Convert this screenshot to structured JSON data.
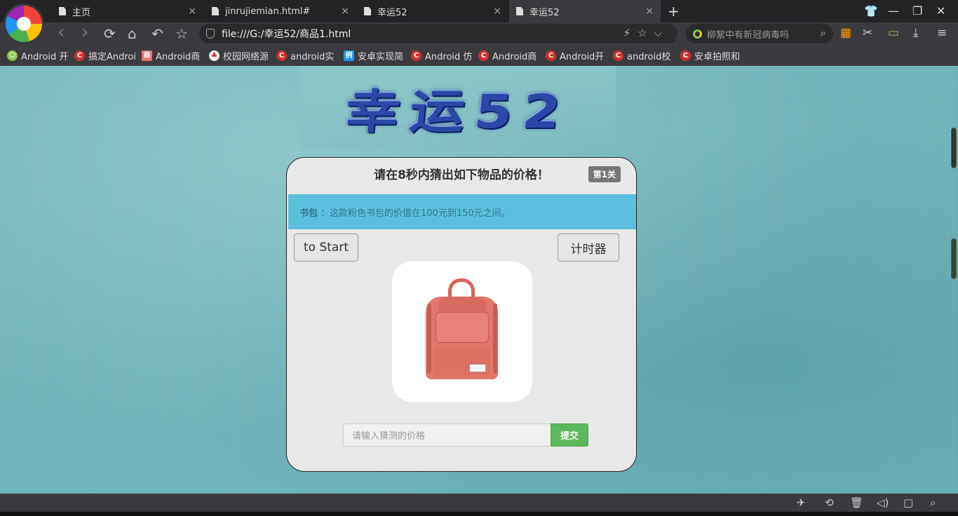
{
  "tabs": [
    {
      "label": "主页",
      "active": false
    },
    {
      "label": "jinrujiemian.html#",
      "active": false
    },
    {
      "label": "幸运52",
      "active": false
    },
    {
      "label": "幸运52",
      "active": true
    }
  ],
  "tab_close_glyph": "×",
  "new_tab_glyph": "+",
  "window_controls": {
    "skin": "👕",
    "minimize": "—",
    "restore": "❐",
    "close": "✕"
  },
  "toolbar": {
    "back": "‹",
    "forward": "›",
    "reload": "⟳",
    "home": "⌂",
    "undo": "↶",
    "star": "☆",
    "address": "file:///G:/幸运52/商品1.html",
    "address_actions": "⚡☆⌵",
    "search_placeholder": "柳絮中有新冠病毒吗",
    "search_glyph": "⌕",
    "right_icons": [
      "▦",
      "✂",
      "▭",
      "⤓",
      "≡"
    ]
  },
  "bookmarks": [
    {
      "label": "Android 开",
      "color": "#8bc34a",
      "glyph": "☺"
    },
    {
      "label": "搞定Androi",
      "color": "#d32f2f",
      "glyph": "C"
    },
    {
      "label": "Android商",
      "color": "#e57373",
      "glyph": "商"
    },
    {
      "label": "校园网络源",
      "color": "#f5f5f5",
      "glyph": "♣"
    },
    {
      "label": "android实",
      "color": "#d32f2f",
      "glyph": "C"
    },
    {
      "label": "安卓实现简",
      "color": "#2196f3",
      "glyph": "例"
    },
    {
      "label": "Android 仿",
      "color": "#d32f2f",
      "glyph": "C"
    },
    {
      "label": "Android商",
      "color": "#d32f2f",
      "glyph": "C"
    },
    {
      "label": "Android开",
      "color": "#d32f2f",
      "glyph": "C"
    },
    {
      "label": "android校",
      "color": "#d32f2f",
      "glyph": "C"
    },
    {
      "label": "安卓拍照和",
      "color": "#d32f2f",
      "glyph": "C"
    }
  ],
  "page": {
    "logo": "幸运52",
    "title": "请在8秒内猜出如下物品的价格！",
    "level": "第1关",
    "info_name": "书包",
    "info_text": "：这款粉色书包的价值在100元到150元之间。",
    "start_button": "to Start",
    "timer_button": "计时器",
    "product": "pink backpack",
    "guess_placeholder": "请输入猜测的价格",
    "submit_button": "提交"
  },
  "status_icons": [
    "✈",
    "⟲",
    "🗑",
    "◁)",
    "▢",
    "⌕"
  ],
  "colors": {
    "info_bar": "#5bc0de",
    "submit": "#5cb85c",
    "badge": "#777777",
    "background": "#6fb6bb"
  }
}
